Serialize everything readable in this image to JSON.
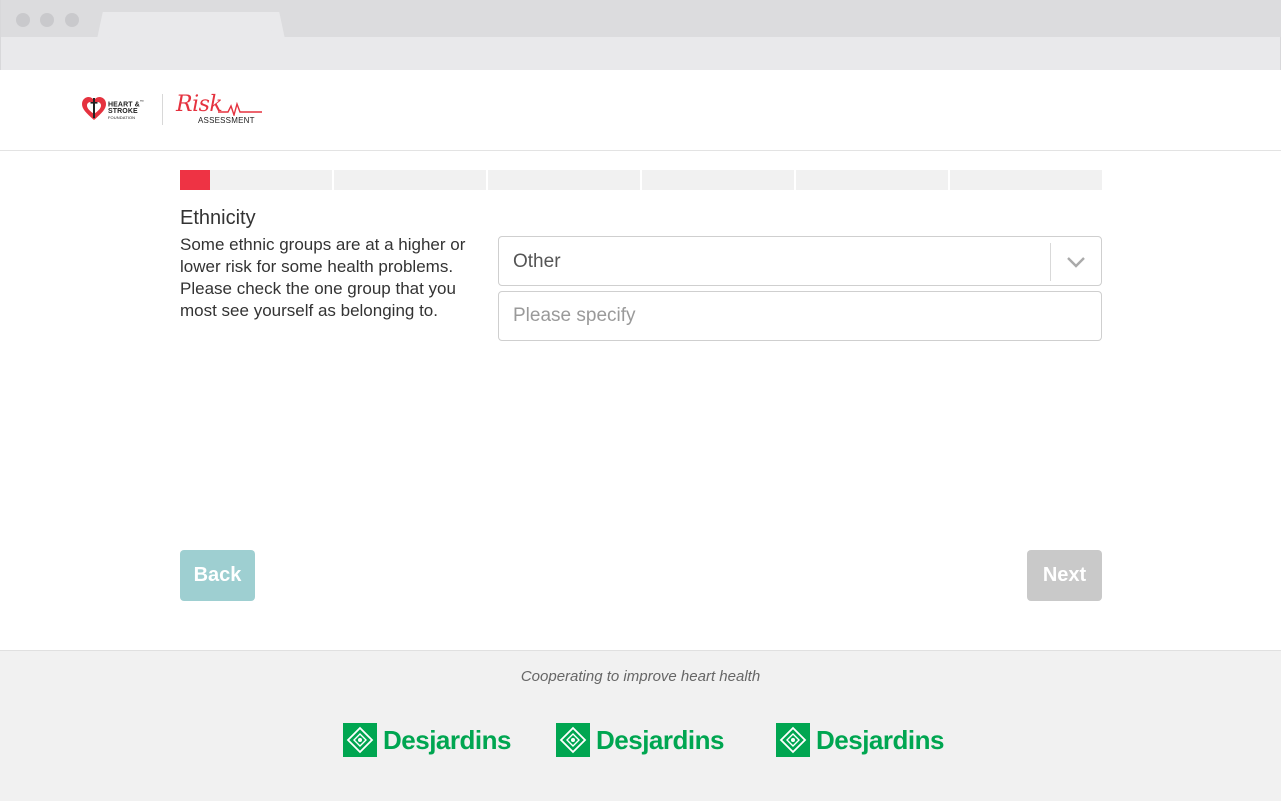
{
  "header": {
    "hsf_logo_lines": [
      "HEART &",
      "STROKE",
      "FOUNDATION"
    ],
    "tm": "™",
    "risk_word": "Risk",
    "risk_sub": "ASSESSMENT"
  },
  "progress": {
    "segments": 6,
    "current_segment": 1,
    "fill_fraction": 0.2
  },
  "question": {
    "title": "Ethnicity",
    "description": "Some ethnic groups are at a higher or lower risk for some health problems. Please check the one group that you most see yourself as belonging to.",
    "select_value": "Other",
    "specify_placeholder": "Please specify",
    "specify_value": ""
  },
  "nav": {
    "back_label": "Back",
    "next_label": "Next"
  },
  "footer": {
    "tagline": "Cooperating to improve heart health",
    "sponsor_names": [
      "Desjardins",
      "Desjardins",
      "Desjardins"
    ]
  },
  "colors": {
    "accent_red": "#ee3344",
    "back_button": "#9ecfd1",
    "next_button_disabled": "#c9c9c9",
    "desjardins_green": "#00a651"
  }
}
